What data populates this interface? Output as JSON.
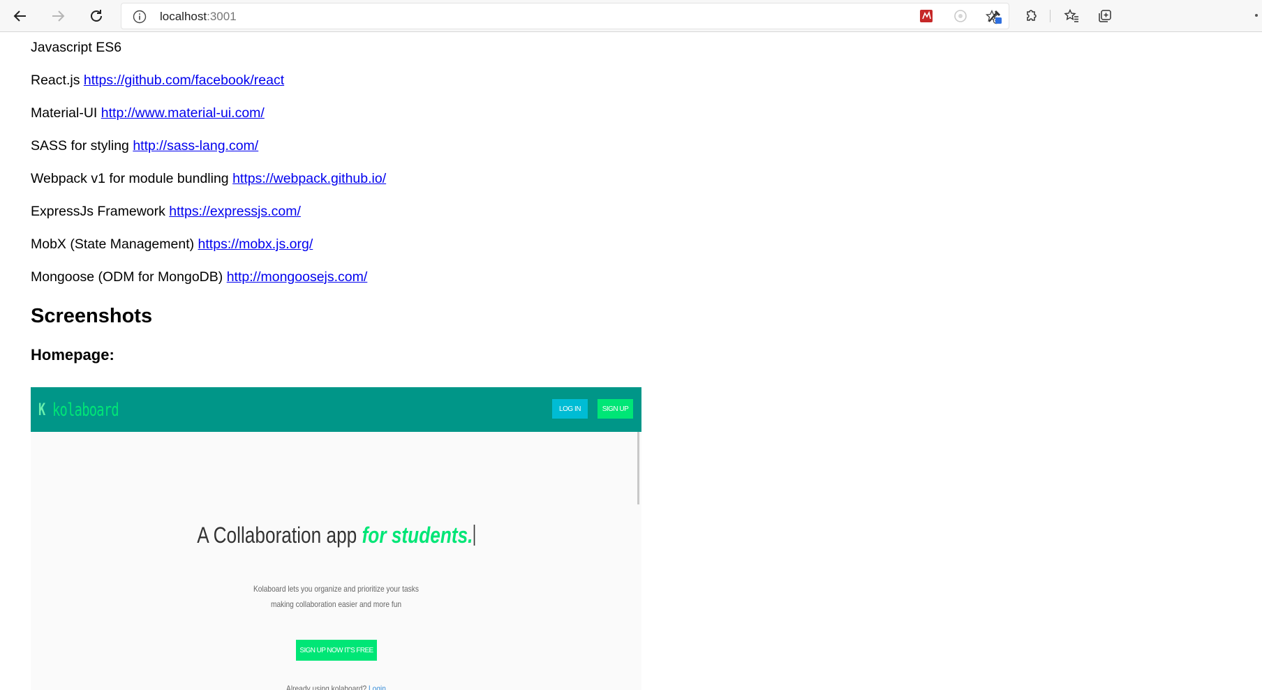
{
  "browser": {
    "url_host": "localhost",
    "url_port": ":3001"
  },
  "tech_list": [
    {
      "label": "Javascript ES6",
      "link": ""
    },
    {
      "label": "React.js",
      "link": "https://github.com/facebook/react"
    },
    {
      "label": "Material-UI",
      "link": "http://www.material-ui.com/"
    },
    {
      "label": "SASS for styling",
      "link": "http://sass-lang.com/"
    },
    {
      "label": "Webpack v1 for module bundling",
      "link": "https://webpack.github.io/"
    },
    {
      "label": "ExpressJs Framework",
      "link": "https://expressjs.com/"
    },
    {
      "label": "MobX (State Management)",
      "link": "https://mobx.js.org/"
    },
    {
      "label": "Mongoose (ODM for MongoDB)",
      "link": "http://mongoosejs.com/"
    }
  ],
  "headings": {
    "screenshots": "Screenshots",
    "homepage": "Homepage:"
  },
  "screenshot": {
    "logo_letter": "K",
    "logo_text": "kolaboard",
    "login_label": "LOG IN",
    "signup_label": "SIGN UP",
    "headline_plain": "A Collaboration app ",
    "headline_accent": "for students.",
    "desc_line1": "Kolaboard lets you organize and prioritize your tasks",
    "desc_line2": "making collaboration easier and more fun",
    "cta_label": "SIGN UP NOW IT'S FREE",
    "already_text": "Already using kolaboard?",
    "already_link": "Login"
  },
  "colors": {
    "link": "#0000ee",
    "teal": "#009688",
    "green_accent": "#00e676",
    "cyan": "#00bcd4"
  }
}
